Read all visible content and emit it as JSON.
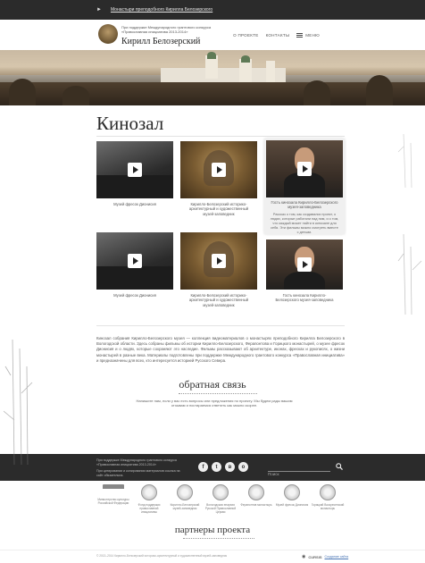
{
  "topbar": {
    "announcement": "Монастыри преподобного Кирилла Белозерского"
  },
  "header": {
    "project_line": "При поддержке Международного грантового конкурса «Православная инициатива 2013-2014»",
    "site_title": "Кирилл Белозерский",
    "nav": {
      "about": "О проекте",
      "contacts": "Контакты",
      "menu": "Меню"
    }
  },
  "page": {
    "title": "Кинозал"
  },
  "videos": [
    {
      "caption": "Музей фресок Дионисия",
      "thumb": "film"
    },
    {
      "caption": "Кирилло-Белозерский историко-архитектурный и художественный музей-заповедник",
      "thumb": "icon"
    },
    {
      "caption": "Гость кинозала Кирилло-Белозерского музея-заповедника",
      "thumb": "person",
      "description": "Рассказ о том, как создавался проект, о людях, которые работали над ним, и о том, что каждый может найти в кинозале для себя. Эти фильмы можно смотреть вместе с детьми."
    },
    {
      "caption": "Музей фресок Дионисия",
      "thumb": "film"
    },
    {
      "caption": "Кирилло-Белозерский историко-архитектурный и художественный музей-заповедник",
      "thumb": "icon"
    },
    {
      "caption": "Гость кинозала Кирилло-Белозерского музея-заповедника",
      "thumb": "person"
    }
  ],
  "intro_text": "Кинозал собрания Кирилло-Белозерского музея — коллекция видеоматериалов о монастырях преподобного Кирилла Белозерского в Вологодской области. Здесь собраны фильмы об истории Кирилло-Белозерского, Ферапонтова и Горицкого монастырей, о музее фресок Дионисия и о людях, которые сохраняют это наследие. Фильмы рассказывают об архитектуре, иконах, фресках и рукописях, о жизни монастырей в разные века. Материалы подготовлены при поддержке Международного грантового конкурса «Православная инициатива» и предназначены для всех, кто интересуется историей Русского Севера.",
  "feedback": {
    "title": "обратная связь",
    "text": "Напишите нам, если у вас есть вопросы или предложения по проекту. Мы будем рады вашим отзывам и постараемся ответить как можно скорее."
  },
  "footer": {
    "project_text": "При поддержке Международного грантового конкурса «Православная инициатива 2013-2014»",
    "rights_text": "При цитировании и копировании материалов ссылка на сайт обязательна.",
    "socials": [
      "f",
      "t",
      "в",
      "о"
    ],
    "search_placeholder": "Поиск"
  },
  "partners": [
    {
      "name": "Министерство культуры Российской Федерации",
      "logo": "flag"
    },
    {
      "name": "Фонд поддержки православной инициативы",
      "logo": "seal"
    },
    {
      "name": "Кирилло-Белозерский музей-заповедник",
      "logo": "seal"
    },
    {
      "name": "Вологодская епархия Русской Православной Церкви",
      "logo": "seal"
    },
    {
      "name": "Ферапонтов монастырь",
      "logo": "seal"
    },
    {
      "name": "Музей фресок Дионисия",
      "logo": "seal"
    },
    {
      "name": "Горицкий Воскресенский монастырь",
      "logo": "seal"
    }
  ],
  "partners_title": "партнеры проекта",
  "bottom": {
    "copyright": "© 2013–2014 Кирилло-Белозерский историко-архитектурный и художественный музей-заповедник",
    "developer_name": "CURSIS",
    "developer_link": "Создание сайта"
  },
  "colors": {
    "dark_bar": "#2b2b2b",
    "background": "#ffffff",
    "highlight_card": "#f0f0f0"
  }
}
